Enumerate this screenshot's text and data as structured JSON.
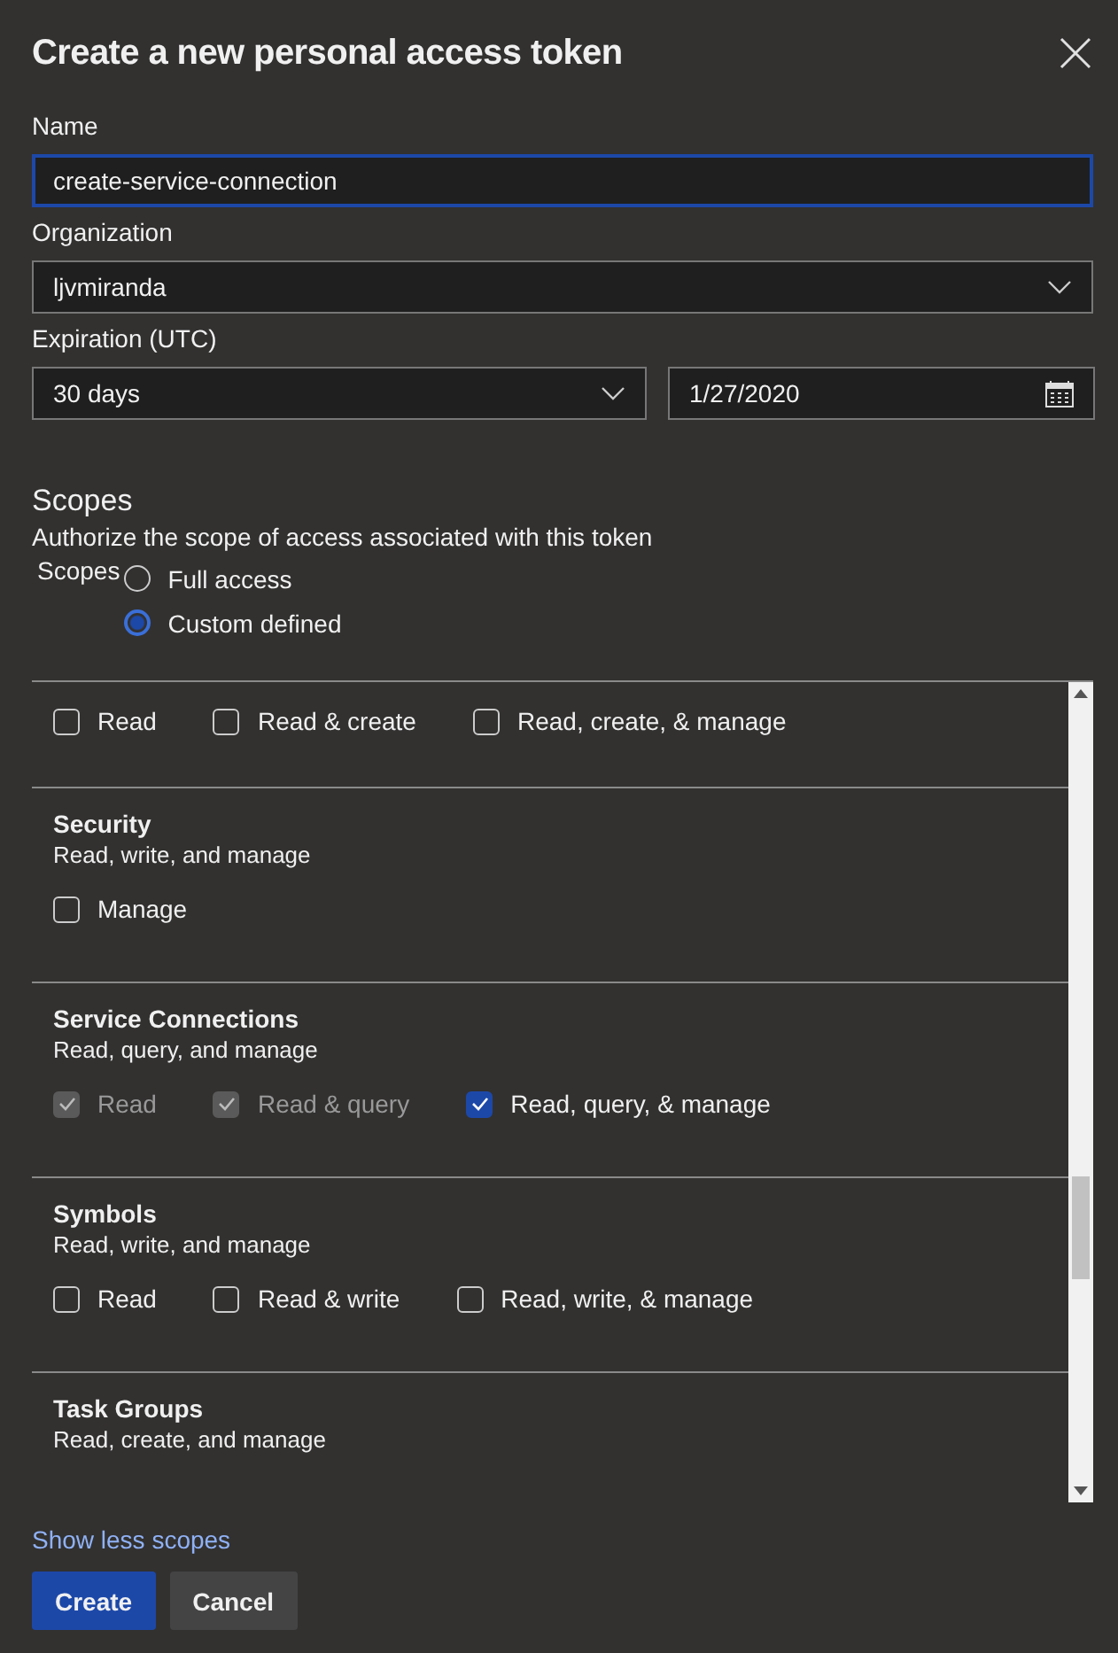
{
  "dialog": {
    "title": "Create a new personal access token"
  },
  "name_field": {
    "label": "Name",
    "value": "create-service-connection",
    "focused": true
  },
  "organization": {
    "label": "Organization",
    "value": "ljvmiranda"
  },
  "expiration": {
    "label": "Expiration (UTC)",
    "duration": "30 days",
    "date": "1/27/2020"
  },
  "scopes": {
    "heading": "Scopes",
    "description": "Authorize the scope of access associated with this token",
    "radio_label": "Scopes",
    "options": [
      {
        "label": "Full access",
        "selected": false
      },
      {
        "label": "Custom defined",
        "selected": true
      }
    ]
  },
  "scope_sections": [
    {
      "options": [
        {
          "label": "Read",
          "checked": false,
          "disabled": false
        },
        {
          "label": "Read & create",
          "checked": false,
          "disabled": false
        },
        {
          "label": "Read, create, & manage",
          "checked": false,
          "disabled": false
        }
      ]
    },
    {
      "title": "Security",
      "subtitle": "Read, write, and manage",
      "options": [
        {
          "label": "Manage",
          "checked": false,
          "disabled": false
        }
      ]
    },
    {
      "title": "Service Connections",
      "subtitle": "Read, query, and manage",
      "options": [
        {
          "label": "Read",
          "checked": true,
          "disabled": true
        },
        {
          "label": "Read & query",
          "checked": true,
          "disabled": true
        },
        {
          "label": "Read, query, & manage",
          "checked": true,
          "disabled": false
        }
      ]
    },
    {
      "title": "Symbols",
      "subtitle": "Read, write, and manage",
      "options": [
        {
          "label": "Read",
          "checked": false,
          "disabled": false
        },
        {
          "label": "Read & write",
          "checked": false,
          "disabled": false
        },
        {
          "label": "Read, write, & manage",
          "checked": false,
          "disabled": false
        }
      ]
    },
    {
      "title": "Task Groups",
      "subtitle": "Read, create, and manage"
    }
  ],
  "toggle_link": "Show less scopes",
  "buttons": [
    {
      "label": "Create",
      "kind": "primary"
    },
    {
      "label": "Cancel",
      "kind": "secondary"
    }
  ]
}
